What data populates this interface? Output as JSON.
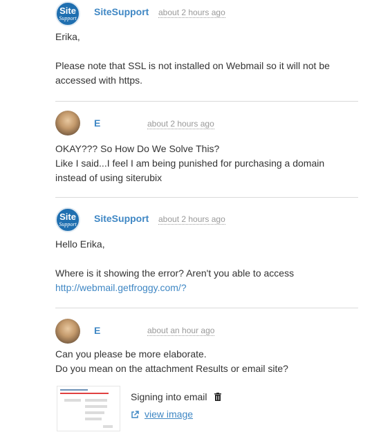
{
  "messages": [
    {
      "author": "SiteSupport",
      "avatar_line1": "Site",
      "avatar_line2": "Support",
      "time": "about 2 hours ago",
      "lines": [
        "Erika,",
        "",
        "Please note that SSL is not installed on Webmail so it will not be",
        "accessed with https."
      ]
    },
    {
      "author": "E",
      "time": "about 2 hours ago",
      "lines": [
        "OKAY??? So How Do We Solve This?",
        "Like I said...I feel I am being punished for purchasing a domain",
        "instead of using siterubix"
      ]
    },
    {
      "author": "SiteSupport",
      "avatar_line1": "Site",
      "avatar_line2": "Support",
      "time": "about 2 hours ago",
      "lines": [
        "Hello Erika,",
        "",
        "Where is it showing the error? Aren't you able to access"
      ],
      "link": "http://webmail.getfroggy.com/?"
    },
    {
      "author": "E",
      "time": "about an hour ago",
      "lines": [
        "Can you please be more elaborate.",
        "Do you mean on the attachment Results or email site?"
      ],
      "attachment": {
        "name": "Signing into email",
        "view_label": "view image"
      }
    }
  ],
  "colors": {
    "link": "#3f87c4",
    "text": "#333333",
    "muted": "#999999",
    "divider": "#d9d9d9"
  }
}
